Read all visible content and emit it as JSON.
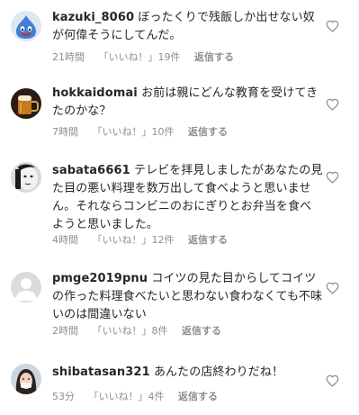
{
  "comments": [
    {
      "username": "kazuki_8060",
      "text": "ぼったくりで残飯しか出せない奴が何偉そうにしてんだ。",
      "time": "21時間",
      "likes": "「いいね！」19件",
      "reply": "返信する",
      "avatar_icon": "slime-avatar-icon"
    },
    {
      "username": "hokkaidomai",
      "text": "お前は親にどんな教育を受けてきたのかな？",
      "time": "7時間",
      "likes": "「いいね！」10件",
      "reply": "返信する",
      "avatar_icon": "beer-mug-avatar-icon"
    },
    {
      "username": "sabata6661",
      "text": "テレビを拝見しましたがあなたの見た目の悪い料理を数万出して食べようと思いません。それならコンビニのおにぎりとお弁当を食べようと思いました。",
      "time": "4時間",
      "likes": "「いいね！」12件",
      "reply": "返信する",
      "avatar_icon": "face-avatar-icon"
    },
    {
      "username": "pmge2019pnu",
      "text": "コイツの見た目からしてコイツの作った料理食べたいと思わない食わなくても不味いのは間違いない",
      "time": "2時間",
      "likes": "「いいね！」8件",
      "reply": "返信する",
      "avatar_icon": "default-user-avatar-icon"
    },
    {
      "username": "shibatasan321",
      "text": "あんたの店終わりだね！",
      "time": "53分",
      "likes": "「いいね！」4件",
      "reply": "返信する",
      "avatar_icon": "woman-avatar-icon"
    }
  ],
  "colors": {
    "text": "#262626",
    "meta": "#8e8e8e",
    "heart_outline": "#8e8e8e"
  }
}
